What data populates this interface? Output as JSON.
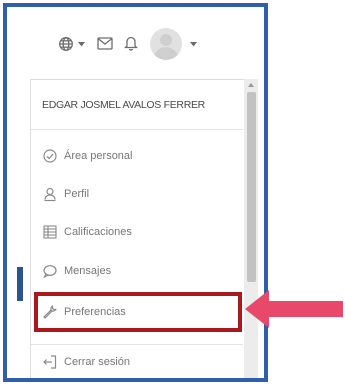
{
  "topbar": {
    "icons": [
      "globe-icon",
      "envelope-icon",
      "bell-icon",
      "avatar"
    ],
    "colors": {
      "frame": "#2e5fa8",
      "highlight": "#a81a1e",
      "arrow": "#e8496b"
    }
  },
  "user_menu": {
    "username": "EDGAR JOSMEL AVALOS FERRER",
    "items": [
      {
        "label": "Área personal",
        "icon": "dashboard-icon"
      },
      {
        "label": "Perfil",
        "icon": "user-icon"
      },
      {
        "label": "Calificaciones",
        "icon": "grades-icon"
      },
      {
        "label": "Mensajes",
        "icon": "message-icon"
      },
      {
        "label": "Preferencias",
        "icon": "wrench-icon"
      },
      {
        "label": "Cerrar sesión",
        "icon": "logout-icon"
      }
    ]
  }
}
